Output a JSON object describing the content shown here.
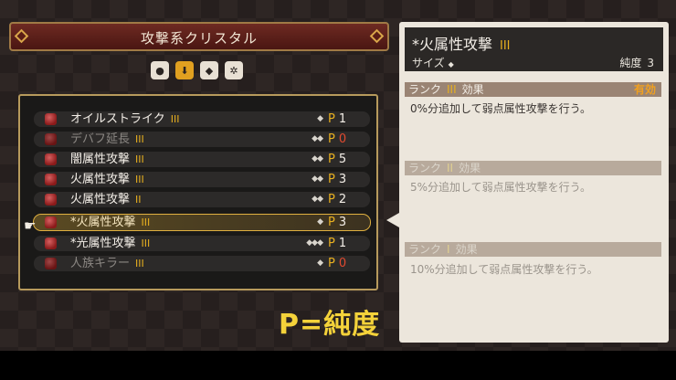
{
  "title": "攻撃系クリスタル",
  "tabs": [
    {
      "icon": "bust-icon",
      "glyph": "●",
      "active": false
    },
    {
      "icon": "down-arrow-icon",
      "glyph": "⬇",
      "active": true
    },
    {
      "icon": "shield-icon",
      "glyph": "◆",
      "active": false
    },
    {
      "icon": "gear-icon",
      "glyph": "✲",
      "active": false
    }
  ],
  "list": [
    {
      "name": "オイルストライク",
      "rank": "III",
      "size": "◆",
      "purity_label": "P",
      "purity": "1"
    },
    {
      "name": "デバフ延長",
      "rank": "III",
      "size": "◆◆",
      "purity_label": "P",
      "purity": "0"
    },
    {
      "name": "闇属性攻撃",
      "rank": "III",
      "size": "◆◆",
      "purity_label": "P",
      "purity": "5"
    },
    {
      "name": "火属性攻撃",
      "rank": "III",
      "size": "◆◆",
      "purity_label": "P",
      "purity": "3"
    },
    {
      "name": "火属性攻撃",
      "rank": "II",
      "size": "◆◆",
      "purity_label": "P",
      "purity": "2"
    },
    {
      "name": "*火属性攻撃",
      "rank": "III",
      "size": "◆",
      "purity_label": "P",
      "purity": "3"
    },
    {
      "name": "*光属性攻撃",
      "rank": "III",
      "size": "◆◆◆",
      "purity_label": "P",
      "purity": "1"
    },
    {
      "name": "人族キラー",
      "rank": "III",
      "size": "◆",
      "purity_label": "P",
      "purity": "0"
    }
  ],
  "caption": "P=純度",
  "detail": {
    "title": "*火属性攻撃",
    "rank": "III",
    "size_label": "サイズ",
    "size_value": "◆",
    "purity_label": "純度",
    "purity_value": "3",
    "effects": [
      {
        "rank_label": "ランク",
        "rank": "III",
        "effect_label": "効果",
        "status": "有効",
        "text": "0%分追加して弱点属性攻撃を行う。"
      },
      {
        "rank_label": "ランク",
        "rank": "II",
        "effect_label": "効果",
        "status": "",
        "text": "5%分追加して弱点属性攻撃を行う。"
      },
      {
        "rank_label": "ランク",
        "rank": "I",
        "effect_label": "効果",
        "status": "",
        "text": "10%分追加して弱点属性攻撃を行う。"
      }
    ]
  }
}
